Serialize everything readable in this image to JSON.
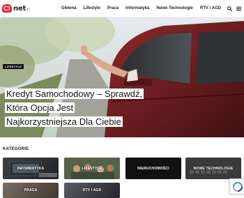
{
  "logo": {
    "name": "net",
    "tld": ".pl"
  },
  "nav": {
    "items": [
      "Główna",
      "Lifestyle",
      "Praca",
      "Informatyka",
      "Nowe Technologie",
      "RTV i AGD"
    ]
  },
  "hero": {
    "category": "LIFESTYLE",
    "title": "Kredyt Samochodowy – Sprawdź, Która Opcja Jest Najkorzystniejsza Dla Ciebie"
  },
  "categories": {
    "heading": "KATEGORIE",
    "tiles": [
      "INFORMATYKA",
      "LIFESTYLE",
      "NIERUCHOMOŚCI",
      "NOWE TECHNOLOGIE",
      "PRACA",
      "RTV I AGD"
    ]
  },
  "colors": {
    "brand": "#e8253a",
    "dark": "#111111",
    "tag_bg": "#111111"
  },
  "icons": [
    "search-icon",
    "menu-icon",
    "recaptcha-icon"
  ]
}
